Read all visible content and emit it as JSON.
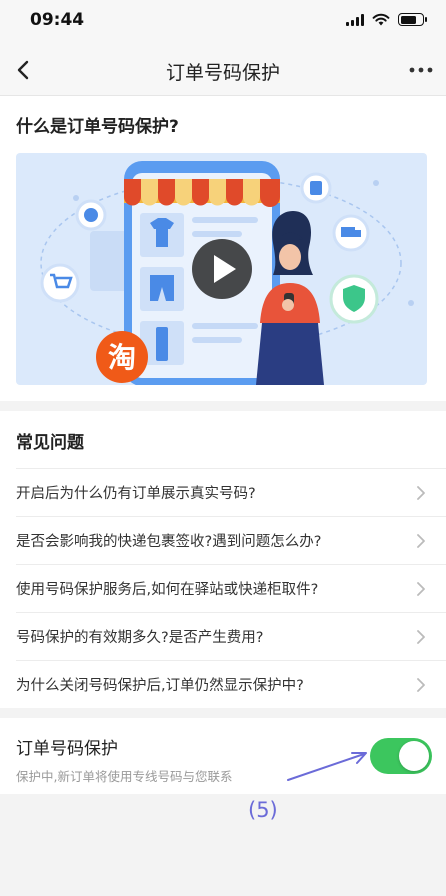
{
  "status_bar": {
    "time": "09:44"
  },
  "nav": {
    "title": "订单号码保护"
  },
  "intro": {
    "title": "什么是订单号码保护?",
    "brand_glyph": "淘"
  },
  "faq": {
    "heading": "常见问题",
    "items": [
      {
        "label": "开启后为什么仍有订单展示真实号码?"
      },
      {
        "label": "是否会影响我的快递包裹签收?遇到问题怎么办?"
      },
      {
        "label": "使用号码保护服务后,如何在驿站或快递柜取件?"
      },
      {
        "label": "号码保护的有效期多久?是否产生费用?"
      },
      {
        "label": "为什么关闭号码保护后,订单仍然显示保护中?"
      }
    ]
  },
  "setting": {
    "title": "订单号码保护",
    "description": "保护中,新订单将使用专线号码与您联系",
    "toggle_on": true
  },
  "annotation": {
    "label": "(5)"
  },
  "colors": {
    "toggle_on": "#3cc65e",
    "annotation": "#6b6bd8",
    "brand_orange": "#f05a18"
  }
}
